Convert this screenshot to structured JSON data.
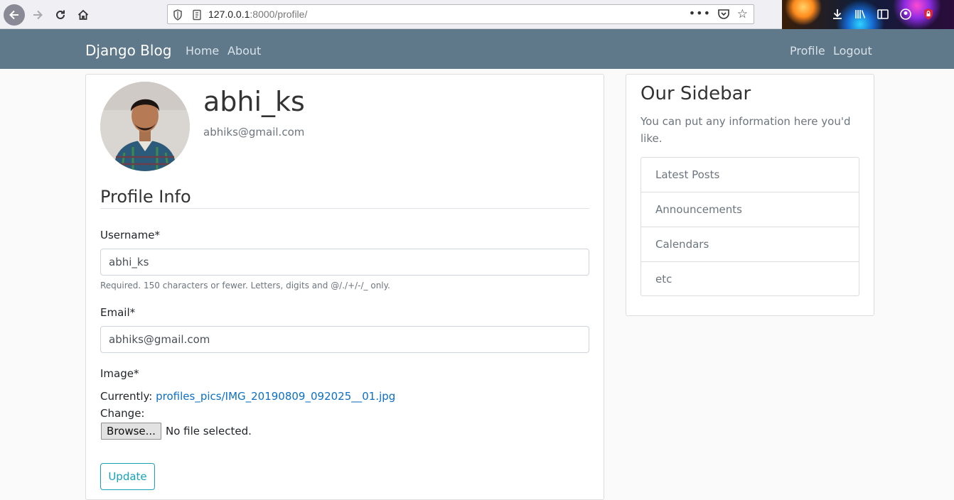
{
  "browser": {
    "url_host": "127.0.0.1",
    "url_rest": ":8000/profile/",
    "menu_dots": "•••"
  },
  "navbar": {
    "brand": "Django Blog",
    "left_links": [
      "Home",
      "About"
    ],
    "right_links": [
      "Profile",
      "Logout"
    ]
  },
  "profile": {
    "username": "abhi_ks",
    "email": "abhiks@gmail.com"
  },
  "form": {
    "section_title": "Profile Info",
    "username_label": "Username*",
    "username_value": "abhi_ks",
    "username_help": "Required. 150 characters or fewer. Letters, digits and @/./+/-/_ only.",
    "email_label": "Email*",
    "email_value": "abhiks@gmail.com",
    "image_label": "Image*",
    "currently_label": "Currently:",
    "current_file": "profiles_pics/IMG_20190809_092025__01.jpg",
    "change_label": "Change:",
    "browse_label": "Browse...",
    "no_file_label": "No file selected.",
    "update_label": "Update"
  },
  "sidebar": {
    "title": "Our Sidebar",
    "text": "You can put any information here you'd like.",
    "items": [
      "Latest Posts",
      "Announcements",
      "Calendars",
      "etc"
    ]
  },
  "colors": {
    "navbar": "#5f788a",
    "link": "#0d6fc4",
    "update_button": "#17a2b8"
  }
}
